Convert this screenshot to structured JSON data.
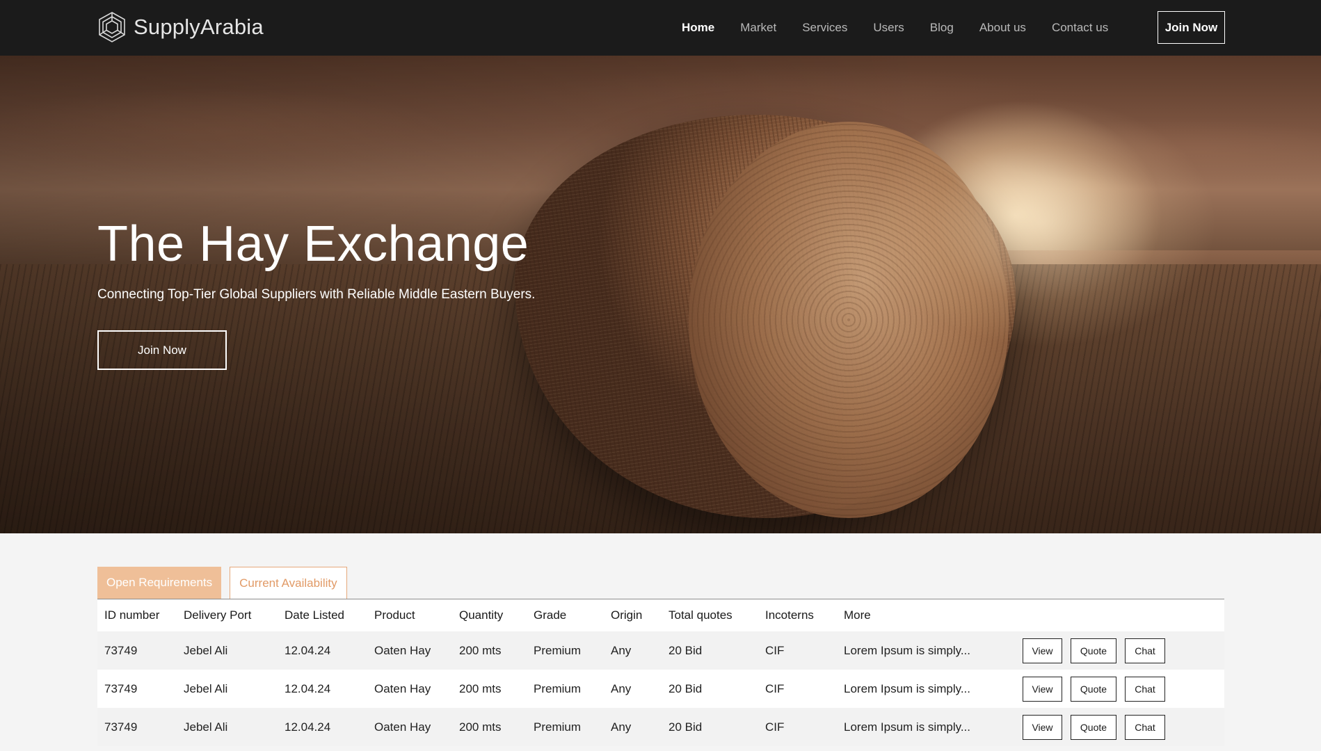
{
  "brand": {
    "name": "SupplyArabia",
    "logo_icon": "hexagon-cube-icon"
  },
  "nav": {
    "links": [
      {
        "label": "Home",
        "active": true
      },
      {
        "label": "Market",
        "active": false
      },
      {
        "label": "Services",
        "active": false
      },
      {
        "label": "Users",
        "active": false
      },
      {
        "label": "Blog",
        "active": false
      },
      {
        "label": "About us",
        "active": false
      },
      {
        "label": "Contact us",
        "active": false
      }
    ],
    "join_label": "Join Now"
  },
  "hero": {
    "title": "The Hay Exchange",
    "subtitle": "Connecting Top-Tier Global Suppliers with Reliable Middle Eastern Buyers.",
    "cta_label": "Join Now"
  },
  "listings": {
    "tabs": [
      {
        "label": "Open Requirements",
        "active": true
      },
      {
        "label": "Current Availability",
        "active": false
      }
    ],
    "columns": [
      "ID number",
      "Delivery Port",
      "Date Listed",
      "Product",
      "Quantity",
      "Grade",
      "Origin",
      "Total quotes",
      "Incoterns",
      "More"
    ],
    "actions": {
      "view": "View",
      "quote": "Quote",
      "chat": "Chat"
    },
    "rows": [
      {
        "id": "73749",
        "port": "Jebel Ali",
        "date": "12.04.24",
        "product": "Oaten Hay",
        "quantity": "200 mts",
        "grade": "Premium",
        "origin": "Any",
        "quotes": "20 Bid",
        "incoterms": "CIF",
        "more": "Lorem Ipsum is simply..."
      },
      {
        "id": "73749",
        "port": "Jebel Ali",
        "date": "12.04.24",
        "product": "Oaten Hay",
        "quantity": "200 mts",
        "grade": "Premium",
        "origin": "Any",
        "quotes": "20 Bid",
        "incoterms": "CIF",
        "more": "Lorem Ipsum is simply..."
      },
      {
        "id": "73749",
        "port": "Jebel Ali",
        "date": "12.04.24",
        "product": "Oaten Hay",
        "quantity": "200 mts",
        "grade": "Premium",
        "origin": "Any",
        "quotes": "20 Bid",
        "incoterms": "CIF",
        "more": "Lorem Ipsum is simply..."
      }
    ]
  },
  "colors": {
    "nav_bg": "#1b1b1b",
    "accent_tab": "#efbf98",
    "accent_text": "#e19a66",
    "page_bg": "#f4f4f4"
  }
}
